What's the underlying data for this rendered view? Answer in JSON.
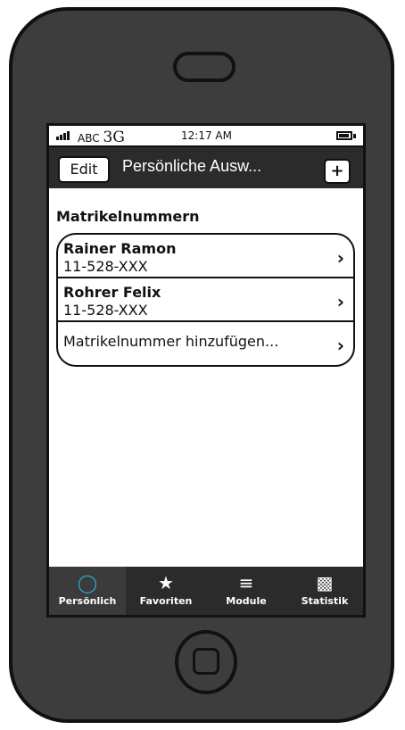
{
  "status": {
    "carrier": "ABC",
    "network": "3G",
    "time": "12:17 AM"
  },
  "nav": {
    "edit_label": "Edit",
    "title": "Persönliche Ausw...",
    "add_label": "+"
  },
  "section": {
    "title": "Matrikelnummern"
  },
  "list": {
    "items": [
      {
        "name": "Rainer Ramon",
        "id": "11-528-XXX"
      },
      {
        "name": "Rohrer Felix",
        "id": "11-528-XXX"
      }
    ],
    "add_label": "Matrikelnummer hinzufügen..."
  },
  "tabs": [
    {
      "label": "Persönlich",
      "icon": "person-icon",
      "active": true
    },
    {
      "label": "Favoriten",
      "icon": "star-icon",
      "active": false
    },
    {
      "label": "Module",
      "icon": "list-icon",
      "active": false
    },
    {
      "label": "Statistik",
      "icon": "chart-icon",
      "active": false
    }
  ],
  "colors": {
    "bar_dark": "#2b2b2b",
    "phone_body": "#3d3d3d",
    "active_tab_icon": "#2aa8d8"
  }
}
